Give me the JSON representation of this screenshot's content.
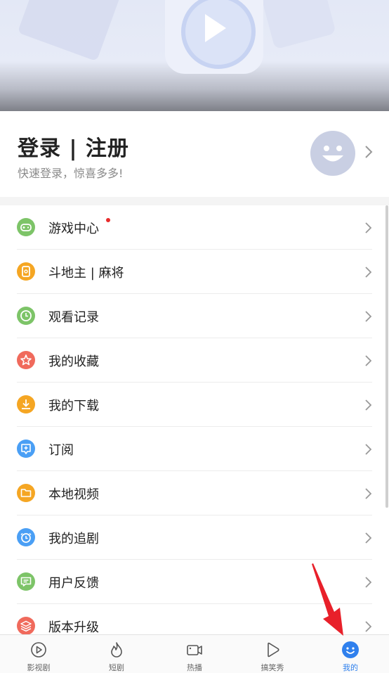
{
  "profile": {
    "title": "登录 | 注册",
    "subtitle": "快速登录，惊喜多多!"
  },
  "menu": {
    "items": [
      {
        "label": "游戏中心",
        "icon": "gamepad-icon",
        "color": "#7dc468",
        "badge": true
      },
      {
        "label": "斗地主 | 麻将",
        "icon": "cards-icon",
        "color": "#f5a623"
      },
      {
        "label": "观看记录",
        "icon": "clock-icon",
        "color": "#7dc468"
      },
      {
        "label": "我的收藏",
        "icon": "star-icon",
        "color": "#f06a5c"
      },
      {
        "label": "我的下载",
        "icon": "download-icon",
        "color": "#f5a623"
      },
      {
        "label": "订阅",
        "icon": "subscribe-icon",
        "color": "#4a9ff5"
      },
      {
        "label": "本地视频",
        "icon": "folder-icon",
        "color": "#f5a623"
      },
      {
        "label": "我的追剧",
        "icon": "alarm-icon",
        "color": "#4a9ff5"
      },
      {
        "label": "用户反馈",
        "icon": "feedback-icon",
        "color": "#7dc468"
      },
      {
        "label": "版本升级",
        "icon": "layers-icon",
        "color": "#f06a5c"
      }
    ]
  },
  "tabbar": {
    "tabs": [
      {
        "label": "影视剧",
        "icon": "play-circle-icon",
        "active": false
      },
      {
        "label": "短剧",
        "icon": "flame-icon",
        "active": false
      },
      {
        "label": "热播",
        "icon": "video-camera-icon",
        "active": false
      },
      {
        "label": "搞笑秀",
        "icon": "play-outline-icon",
        "active": false
      },
      {
        "label": "我的",
        "icon": "smiley-icon",
        "active": true
      }
    ]
  },
  "colors": {
    "accent": "#2f80ed",
    "badge": "#e82b2b",
    "annotation_arrow": "#e8202a"
  }
}
